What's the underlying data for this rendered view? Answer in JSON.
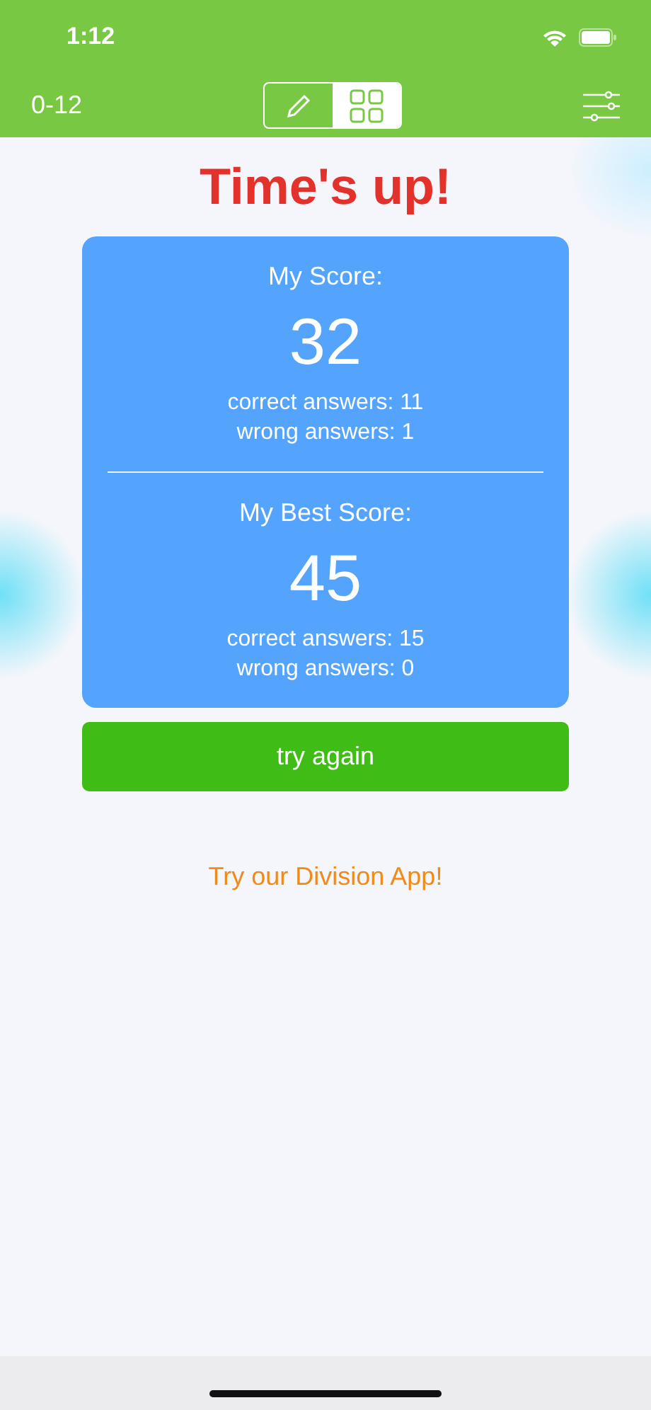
{
  "status_bar": {
    "time": "1:12"
  },
  "nav_bar": {
    "range": "0-12",
    "modes": [
      {
        "kind": "pencil",
        "selected": false
      },
      {
        "kind": "grid",
        "selected": true
      }
    ]
  },
  "title": "Time's up!",
  "scores": [
    {
      "heading": "My Score:",
      "value": "32",
      "correct": "correct answers: 11",
      "wrong": "wrong answers: 1"
    },
    {
      "heading": "My Best Score:",
      "value": "45",
      "correct": "correct answers: 15",
      "wrong": "wrong answers: 0"
    }
  ],
  "retry_button": "try again",
  "promo_link": "Try our Division App!"
}
